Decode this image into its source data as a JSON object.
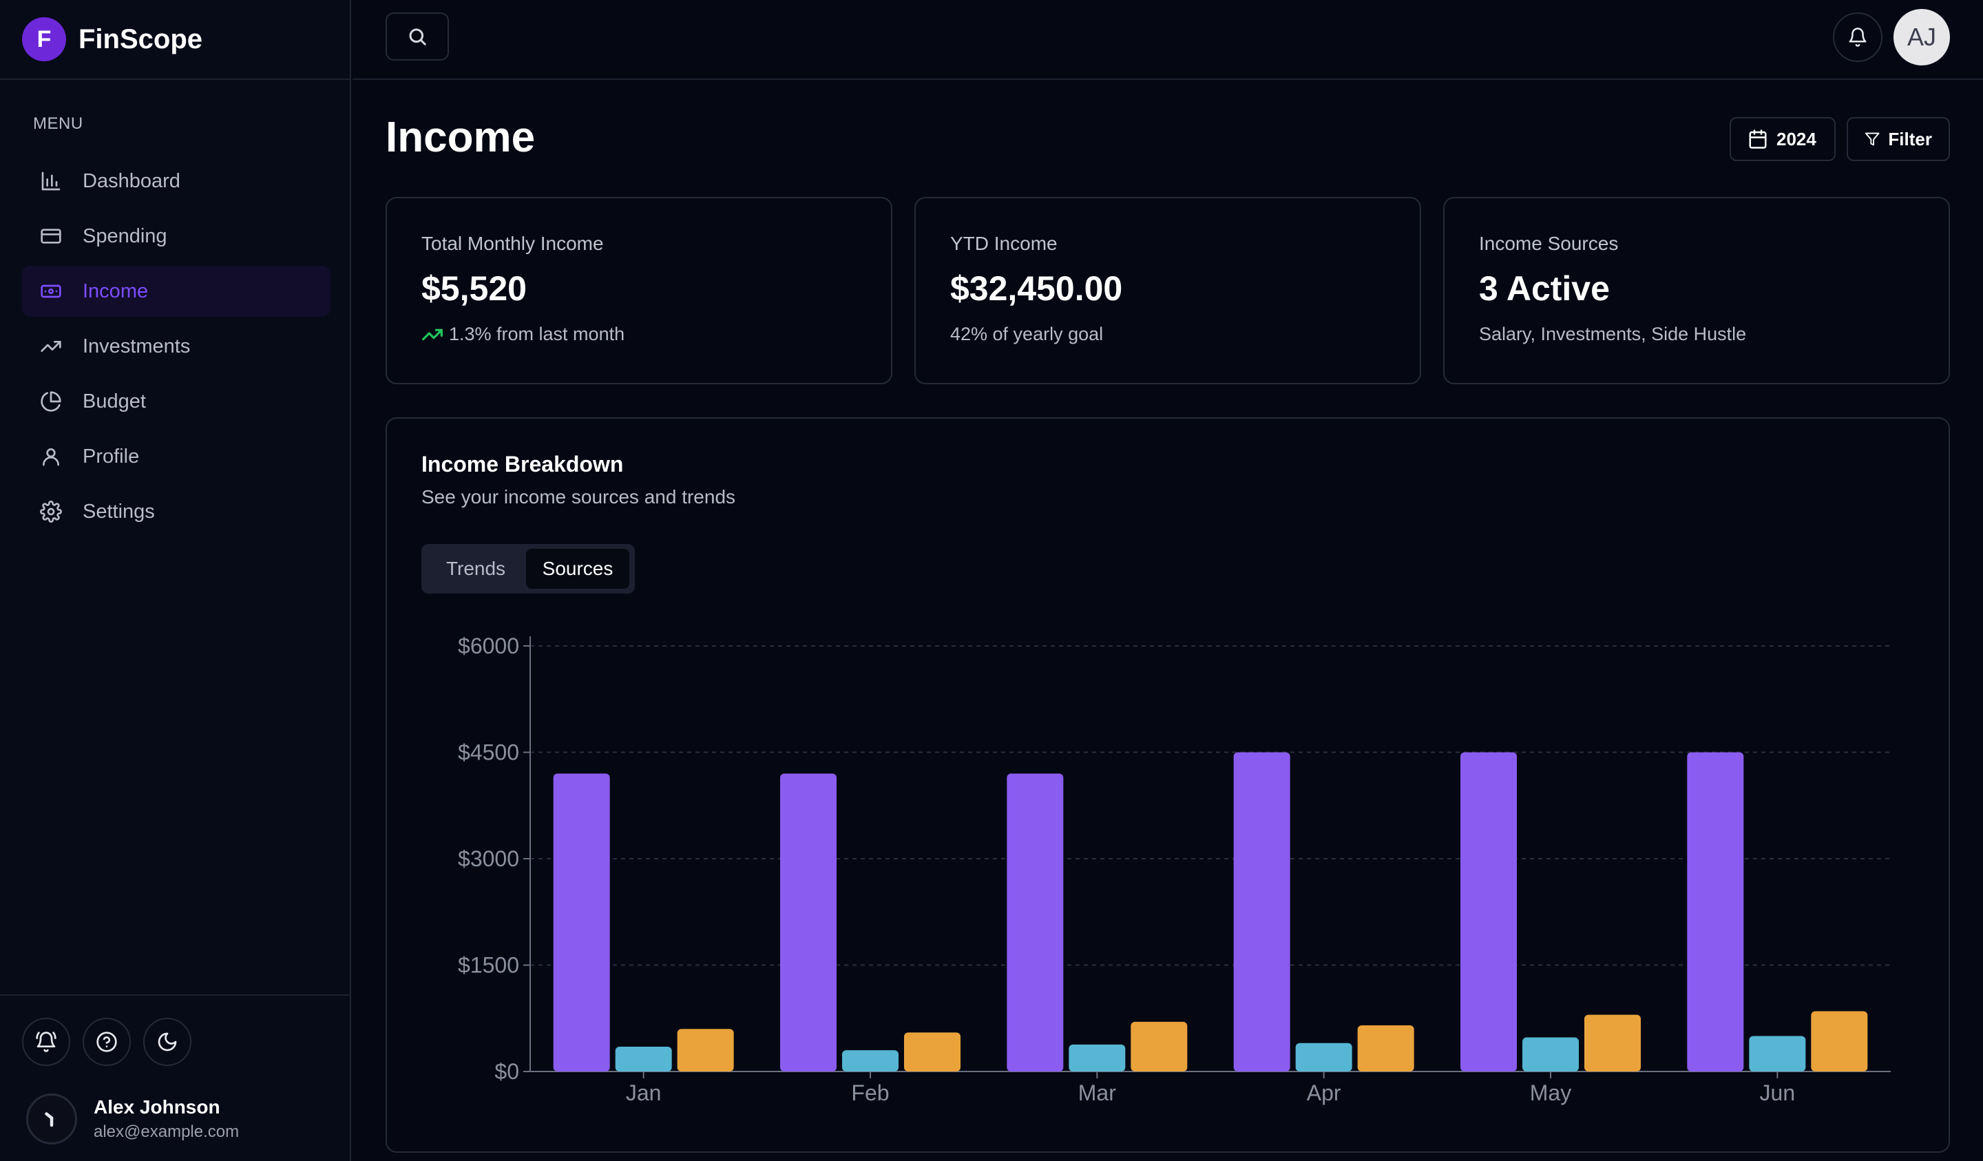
{
  "brand": {
    "initial": "F",
    "name": "FinScope"
  },
  "sidebar": {
    "menu_label": "MENU",
    "items": [
      {
        "label": "Dashboard",
        "icon": "bar-chart-icon",
        "active": false
      },
      {
        "label": "Spending",
        "icon": "credit-card-icon",
        "active": false
      },
      {
        "label": "Income",
        "icon": "banknote-icon",
        "active": true
      },
      {
        "label": "Investments",
        "icon": "trending-up-icon",
        "active": false
      },
      {
        "label": "Budget",
        "icon": "pie-chart-icon",
        "active": false
      },
      {
        "label": "Profile",
        "icon": "user-icon",
        "active": false
      },
      {
        "label": "Settings",
        "icon": "gear-icon",
        "active": false
      }
    ],
    "footer_icons": [
      "bell-ring-icon",
      "help-circle-icon",
      "moon-icon"
    ],
    "user": {
      "name": "Alex Johnson",
      "email": "alex@example.com"
    }
  },
  "topbar": {
    "avatar_initials": "AJ"
  },
  "header": {
    "title": "Income",
    "year_label": "2024",
    "filter_label": "Filter"
  },
  "stats": [
    {
      "label": "Total Monthly Income",
      "value": "$5,520",
      "sub": "1.3% from last month",
      "trend_icon": true
    },
    {
      "label": "YTD Income",
      "value": "$32,450.00",
      "sub": "42% of yearly goal",
      "trend_icon": false
    },
    {
      "label": "Income Sources",
      "value": "3 Active",
      "sub": "Salary, Investments, Side Hustle",
      "trend_icon": false
    }
  ],
  "breakdown": {
    "title": "Income Breakdown",
    "subtitle": "See your income sources and trends",
    "tabs": [
      "Trends",
      "Sources"
    ],
    "active_tab": "Sources"
  },
  "colors": {
    "accent": "#7c4dff",
    "series_1": "#8b5cf0",
    "series_2": "#56b6d3",
    "series_3": "#eaa33b"
  },
  "chart_data": {
    "type": "bar",
    "categories": [
      "Jan",
      "Feb",
      "Mar",
      "Apr",
      "May",
      "Jun"
    ],
    "series": [
      {
        "values": [
          4200,
          4200,
          4200,
          4500,
          4500,
          4500
        ]
      },
      {
        "values": [
          350,
          300,
          380,
          400,
          480,
          500
        ]
      },
      {
        "values": [
          600,
          550,
          700,
          650,
          800,
          850
        ]
      }
    ],
    "y_ticks": [
      "$0",
      "$1500",
      "$3000",
      "$4500",
      "$6000"
    ],
    "ylim": [
      0,
      6000
    ],
    "grid": true
  }
}
